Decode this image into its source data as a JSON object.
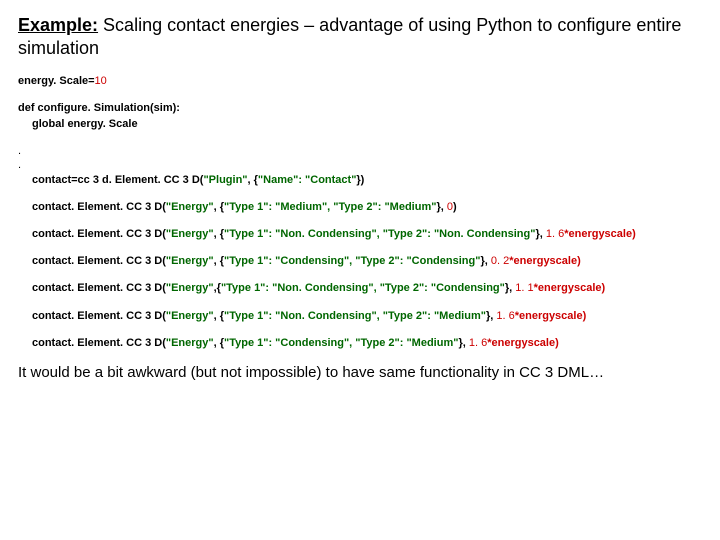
{
  "title": {
    "example_label": "Example:",
    "rest": " Scaling contact energies – advantage of using Python to configure entire simulation"
  },
  "code": {
    "l1_a": "energy. Scale=",
    "l1_b": "10",
    "l2": "def configure. Simulation(sim):",
    "l3": "global energy. Scale",
    "dot": ".",
    "c1_a": "contact=cc 3 d. Element. CC 3 D(",
    "c1_b": "\"Plugin\"",
    "c1_c": ", {",
    "c1_d": "\"Name\": \"Contact\"",
    "c1_e": "})",
    "c2_a": "contact. Element. CC 3 D(",
    "c2_b": "\"Energy\"",
    "c2_c": ", {",
    "c2_d": "\"Type 1\": \"Medium\", \"Type 2\": \"Medium\"",
    "c2_e": "}, ",
    "c2_f": "0",
    "c2_g": ")",
    "c3_a": "contact. Element. CC 3 D(",
    "c3_b": "\"Energy\"",
    "c3_c": ", {",
    "c3_d": "\"Type 1\": \"Non. Condensing\", \"Type 2\": \"Non. Condensing\"",
    "c3_e": "}, ",
    "c3_f": "1. 6",
    "c3_g": "*energyscale)",
    "c4_a": "contact. Element. CC 3 D(",
    "c4_b": "\"Energy\"",
    "c4_c": ", {",
    "c4_d": "\"Type 1\": \"Condensing\", \"Type 2\": \"Condensing\"",
    "c4_e": "}, ",
    "c4_f": "0. 2",
    "c4_g": "*energyscale)",
    "c5_a": "contact. Element. CC 3 D(",
    "c5_b": "\"Energy\"",
    "c5_c": ",{",
    "c5_d": "\"Type 1\": \"Non. Condensing\", \"Type 2\": \"Condensing\"",
    "c5_e": "}, ",
    "c5_f": "1. 1",
    "c5_g": "*energyscale)",
    "c6_a": "contact. Element. CC 3 D(",
    "c6_b": "\"Energy\"",
    "c6_c": ", {",
    "c6_d": "\"Type 1\": \"Non. Condensing\", \"Type 2\": \"Medium\"",
    "c6_e": "}, ",
    "c6_f": "1. 6",
    "c6_g": "*energyscale)",
    "c7_a": "contact. Element. CC 3 D(",
    "c7_b": "\"Energy\"",
    "c7_c": ", {",
    "c7_d": "\"Type 1\": \"Condensing\", \"Type 2\": \"Medium\"",
    "c7_e": "}, ",
    "c7_f": "1. 6",
    "c7_g": "*energyscale)"
  },
  "footer": "It would be a bit awkward (but not impossible) to have same functionality in CC 3 DML…"
}
